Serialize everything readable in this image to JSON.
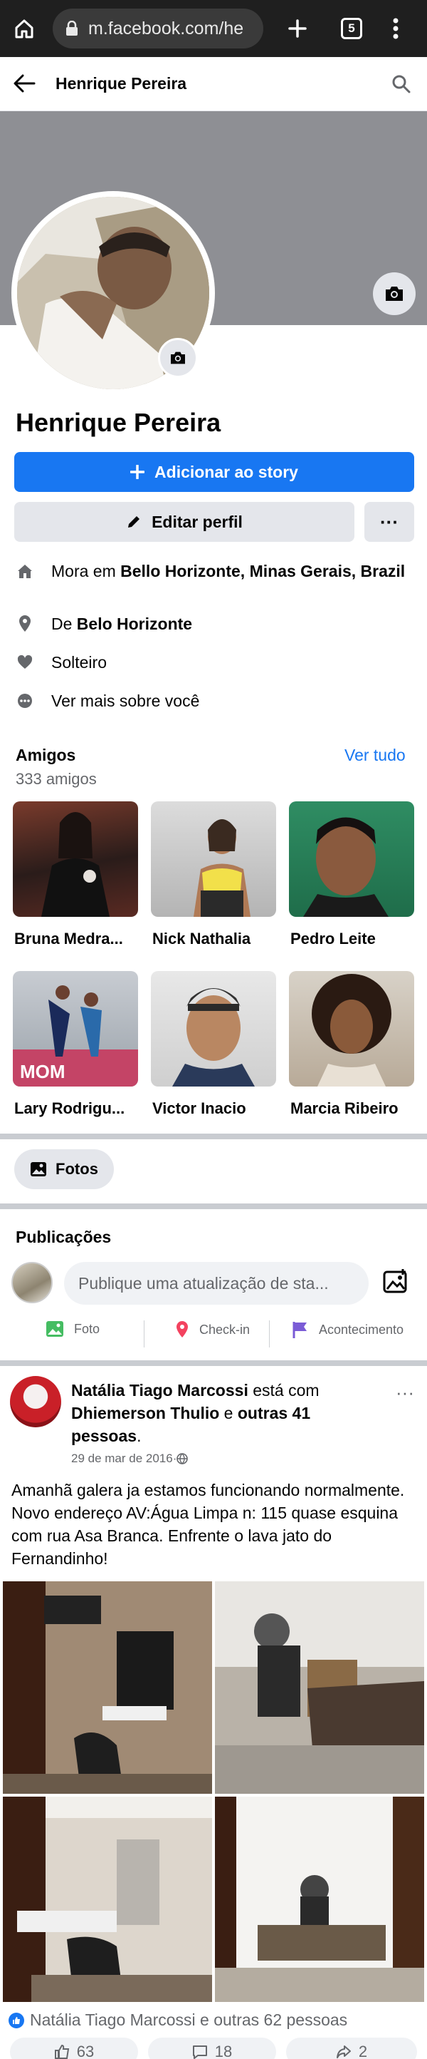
{
  "browser": {
    "url": "m.facebook.com/he",
    "tab_count": "5"
  },
  "header": {
    "title": "Henrique Pereira"
  },
  "profile": {
    "name": "Henrique Pereira",
    "add_story_label": "Adicionar ao story",
    "edit_profile_label": "Editar perfil",
    "more_label": "···"
  },
  "info": {
    "lives_prefix": "Mora em ",
    "lives_city": "Bello Horizonte, Minas Gerais, Brazil",
    "from_prefix": "De ",
    "from_city": "Belo Horizonte",
    "relationship": "Solteiro",
    "see_more": "Ver mais sobre você"
  },
  "friends": {
    "title": "Amigos",
    "count": "333 amigos",
    "see_all": "Ver tudo",
    "items": [
      {
        "name": "Bruna Medra..."
      },
      {
        "name": "Nick Nathalia"
      },
      {
        "name": "Pedro Leite"
      },
      {
        "name": "Lary Rodrigu..."
      },
      {
        "name": "Victor Inacio"
      },
      {
        "name": "Marcia Ribeiro"
      }
    ]
  },
  "photos_button": "Fotos",
  "posts": {
    "title": "Publicações",
    "composer_placeholder": "Publique uma atualização de sta...",
    "actions": [
      "Foto",
      "Check-in",
      "Acontecimento"
    ]
  },
  "post": {
    "author": "Natália Tiago Marcossi",
    "with_text": " está com ",
    "tagged": "Dhiemerson Thulio",
    "and_text": " e ",
    "others": "outras 41 pessoas",
    "period": ".",
    "date": "29 de mar de 2016",
    "dot": " · ",
    "text": "Amanhã galera ja estamos funcionando normalmente. Novo endereço AV:Água Limpa n: 115 quase esquina com rua Asa Branca. Enfrente o lava jato do Fernandinho!",
    "reactions": "Natália Tiago Marcossi e outras 62 pessoas",
    "like_count": "63",
    "comment_count": "18",
    "share_count": "2",
    "image_text": "MOM"
  },
  "colors": {
    "accent": "#1877f2",
    "cover": "#8e8f94",
    "chip": "#e4e6eb"
  }
}
